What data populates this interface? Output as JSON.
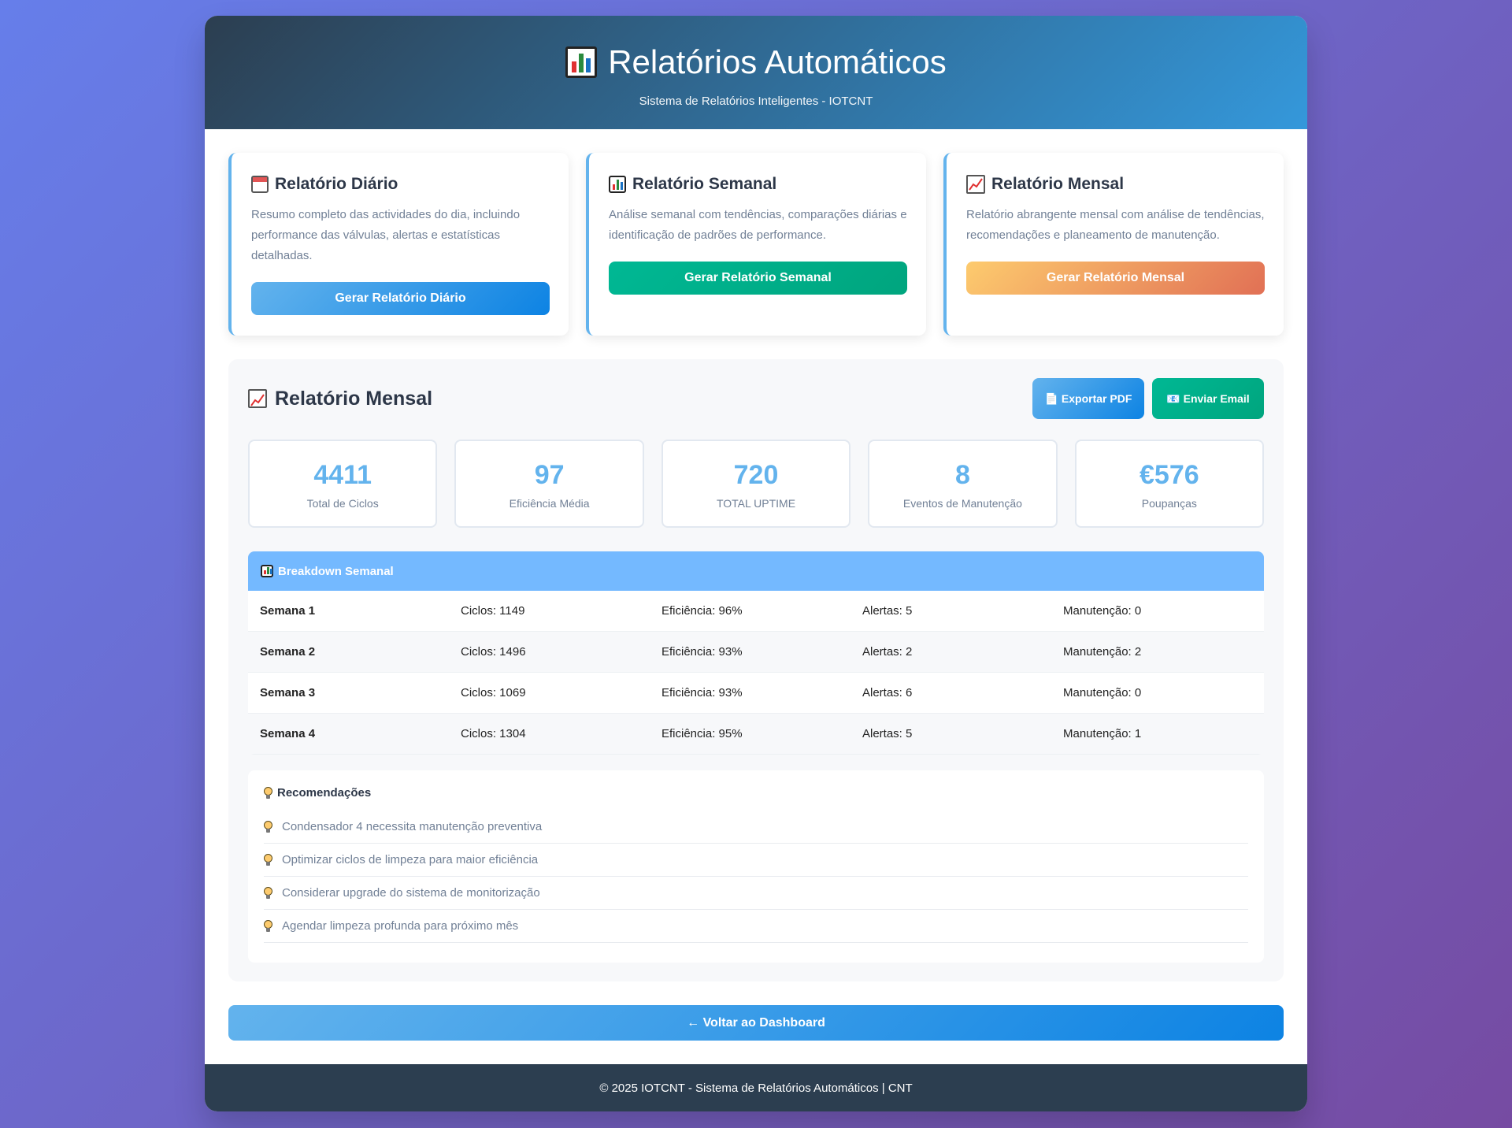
{
  "header": {
    "title": "Relatórios Automáticos",
    "subtitle": "Sistema de Relatórios Inteligentes - IOTCNT",
    "icon": "bar-chart-icon"
  },
  "cards": [
    {
      "icon": "calendar-icon",
      "title": "Relatório Diário",
      "description": "Resumo completo das actividades do dia, incluindo performance das válvulas, alertas e estatísticas detalhadas.",
      "button": "Gerar Relatório Diário"
    },
    {
      "icon": "bar-chart-icon",
      "title": "Relatório Semanal",
      "description": "Análise semanal com tendências, comparações diárias e identificação de padrões de performance.",
      "button": "Gerar Relatório Semanal"
    },
    {
      "icon": "trend-chart-icon",
      "title": "Relatório Mensal",
      "description": "Relatório abrangente mensal com análise de tendências, recomendações e planeamento de manutenção.",
      "button": "Gerar Relatório Mensal"
    }
  ],
  "report": {
    "title": "Relatório Mensal",
    "export_pdf": "📄 Exportar PDF",
    "send_email": "📧 Enviar Email",
    "stats": [
      {
        "value": "4411",
        "label": "Total de Ciclos"
      },
      {
        "value": "97",
        "label": "Eficiência Média"
      },
      {
        "value": "720",
        "label": "TOTAL UPTIME"
      },
      {
        "value": "8",
        "label": "Eventos de Manutenção"
      },
      {
        "value": "€576",
        "label": "Poupanças"
      }
    ],
    "breakdown": {
      "title": "Breakdown Semanal",
      "rows": [
        {
          "week": "Semana 1",
          "cycles": "Ciclos: 1149",
          "efficiency": "Eficiência: 96%",
          "alerts": "Alertas: 5",
          "maintenance": "Manutenção: 0"
        },
        {
          "week": "Semana 2",
          "cycles": "Ciclos: 1496",
          "efficiency": "Eficiência: 93%",
          "alerts": "Alertas: 2",
          "maintenance": "Manutenção: 2"
        },
        {
          "week": "Semana 3",
          "cycles": "Ciclos: 1069",
          "efficiency": "Eficiência: 93%",
          "alerts": "Alertas: 6",
          "maintenance": "Manutenção: 0"
        },
        {
          "week": "Semana 4",
          "cycles": "Ciclos: 1304",
          "efficiency": "Eficiência: 95%",
          "alerts": "Alertas: 5",
          "maintenance": "Manutenção: 1"
        }
      ]
    },
    "recommendations": {
      "title": "Recomendações",
      "items": [
        "Condensador 4 necessita manutenção preventiva",
        "Optimizar ciclos de limpeza para maior eficiência",
        "Considerar upgrade do sistema de monitorização",
        "Agendar limpeza profunda para próximo mês"
      ]
    }
  },
  "back_button": "← Voltar ao Dashboard",
  "footer": "© 2025 IOTCNT - Sistema de Relatórios Automáticos | CNT",
  "colors": {
    "accent_blue": "#63b3ed",
    "accent_green": "#00b894",
    "accent_orange": "#e17055",
    "header_dark": "#2c3e50"
  }
}
